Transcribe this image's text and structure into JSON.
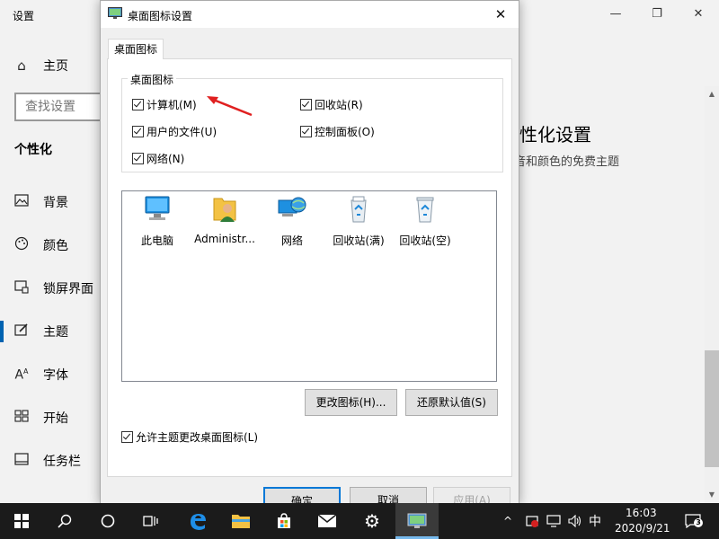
{
  "settings": {
    "title": "设置",
    "window_controls": {
      "minimize": "—",
      "maximize": "❐",
      "close": "✕"
    },
    "home_label": "主页",
    "search_placeholder": "查找设置",
    "category": "个性化",
    "nav_items": [
      {
        "label": "背景",
        "icon": "image-icon"
      },
      {
        "label": "颜色",
        "icon": "palette-icon"
      },
      {
        "label": "锁屏界面",
        "icon": "lock-screen-icon"
      },
      {
        "label": "主题",
        "icon": "brush-icon"
      },
      {
        "label": "字体",
        "icon": "font-icon"
      },
      {
        "label": "开始",
        "icon": "start-grid-icon"
      },
      {
        "label": "任务栏",
        "icon": "taskbar-icon"
      }
    ],
    "content_title": "性化设置",
    "content_subtitle": "音和颜色的免费主题"
  },
  "dialog": {
    "title": "桌面图标设置",
    "tab_label": "桌面图标",
    "group_label": "桌面图标",
    "checkboxes": [
      {
        "label": "计算机(M)",
        "checked": true
      },
      {
        "label": "回收站(R)",
        "checked": true
      },
      {
        "label": "用户的文件(U)",
        "checked": true
      },
      {
        "label": "控制面板(O)",
        "checked": true
      },
      {
        "label": "网络(N)",
        "checked": true
      }
    ],
    "icons": [
      {
        "label": "此电脑",
        "icon": "computer-icon"
      },
      {
        "label": "Administr...",
        "icon": "user-folder-icon"
      },
      {
        "label": "网络",
        "icon": "network-icon"
      },
      {
        "label": "回收站(满)",
        "icon": "recycle-bin-full-icon"
      },
      {
        "label": "回收站(空)",
        "icon": "recycle-bin-empty-icon"
      }
    ],
    "change_icon_button": "更改图标(H)...",
    "restore_default_button": "还原默认值(S)",
    "allow_themes_label": "允许主题更改桌面图标(L)",
    "allow_themes_checked": true,
    "ok_button": "确定",
    "cancel_button": "取消",
    "apply_button": "应用(A)",
    "close_glyph": "✕"
  },
  "taskbar": {
    "pinned": [
      "windows-start-icon",
      "search-icon",
      "cortana-icon",
      "task-view-icon",
      "edge-icon",
      "file-explorer-icon",
      "store-icon",
      "mail-icon",
      "settings-icon",
      "desktop-icon-settings-icon"
    ],
    "ime_label": "中",
    "time": "16:03",
    "date": "2020/9/21",
    "notification_count": "3"
  },
  "colors": {
    "accent": "#0078d7",
    "taskbar": "#1b1b1b",
    "annotation_arrow": "#e02020"
  }
}
